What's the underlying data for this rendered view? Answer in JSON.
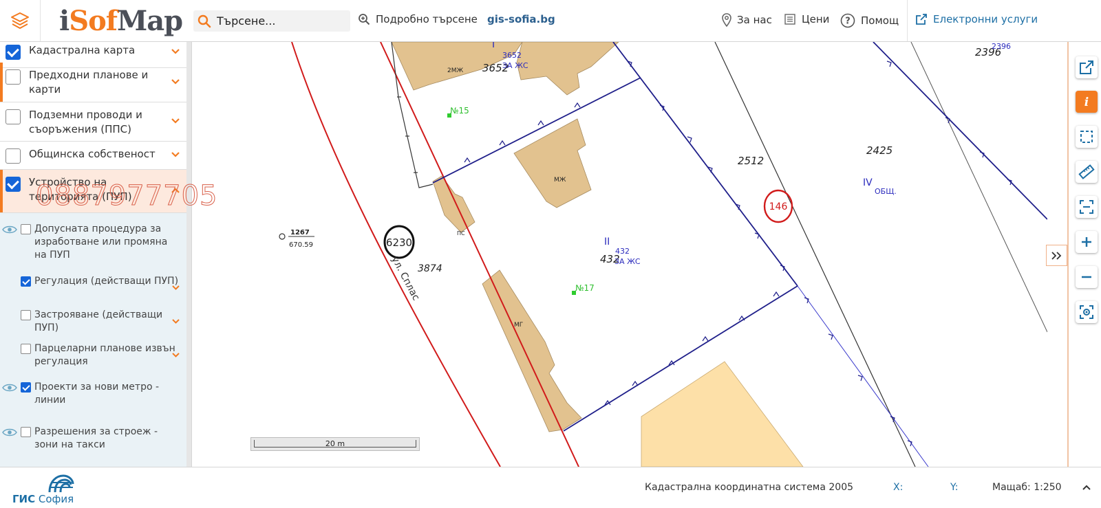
{
  "header": {
    "logo": {
      "part1": "i",
      "part2": "Sof",
      "part3": "Map"
    },
    "search_placeholder": "Търсене...",
    "advanced_search": "Подробно търсене",
    "gis_link": "gis-sofia.bg",
    "about": "За нас",
    "prices": "Цени",
    "help": "Помощ",
    "eservices": "Електронни услуги"
  },
  "sidebar": {
    "layers": [
      {
        "label": "Кадастрална карта",
        "checked": true
      },
      {
        "label": "Предходни планове и карти",
        "checked": false
      },
      {
        "label": "Подземни проводи и съоръжения (ППС)",
        "checked": false
      },
      {
        "label": "Общинска собственост",
        "checked": false
      },
      {
        "label": "Устройство на територията (ПУП)",
        "checked": true
      }
    ],
    "sublayers": [
      {
        "label": "Допусната процедура за изработване или промяна на ПУП",
        "checked": false
      },
      {
        "label": "Регулация (действащи ПУП)",
        "checked": true
      },
      {
        "label": "Застрояване (действащи ПУП)",
        "checked": false
      },
      {
        "label": "Парцеларни планове извън регулация",
        "checked": false
      },
      {
        "label": "Проекти за нови метро - линии",
        "checked": true
      },
      {
        "label": "Разрешения за строеж - зони на такси",
        "checked": false
      }
    ],
    "watermark": "0887977705"
  },
  "map": {
    "scale_label": "20 m",
    "labels": {
      "l3652": "3652",
      "l3652s": "3652",
      "zaj1": "ЗА ЖС",
      "b2mj": "2МЖ",
      "n15": "№15",
      "mj": "МЖ",
      "pc": "ПС",
      "mg": "МГ",
      "n17": "№17",
      "r2": "II",
      "l432": "432",
      "l432s": "432",
      "zaj2": "ЗА ЖС",
      "l2512": "2512",
      "l146": "146",
      "r4": "IV",
      "obsh": "ОБЩ.",
      "l2425": "2425",
      "l2396": "2396",
      "l2396s": "2396",
      "l6230": "6230",
      "l3874": "3874",
      "street": "ул. Сплас",
      "l1267": "1267",
      "l670": "670.59",
      "r1": "I"
    }
  },
  "footer": {
    "gis_brand_bold": "ГИС",
    "gis_brand": "София",
    "coord_system": "Кадастрална координатна система 2005",
    "x_label": "X:",
    "y_label": "Y:",
    "scale": "Мащаб: 1:250"
  },
  "colors": {
    "accent": "#f37b20",
    "blue": "#1565d8",
    "building": "#e2c28f",
    "parcel_line": "#1f1f8a",
    "regulation": "#d11b1b"
  }
}
